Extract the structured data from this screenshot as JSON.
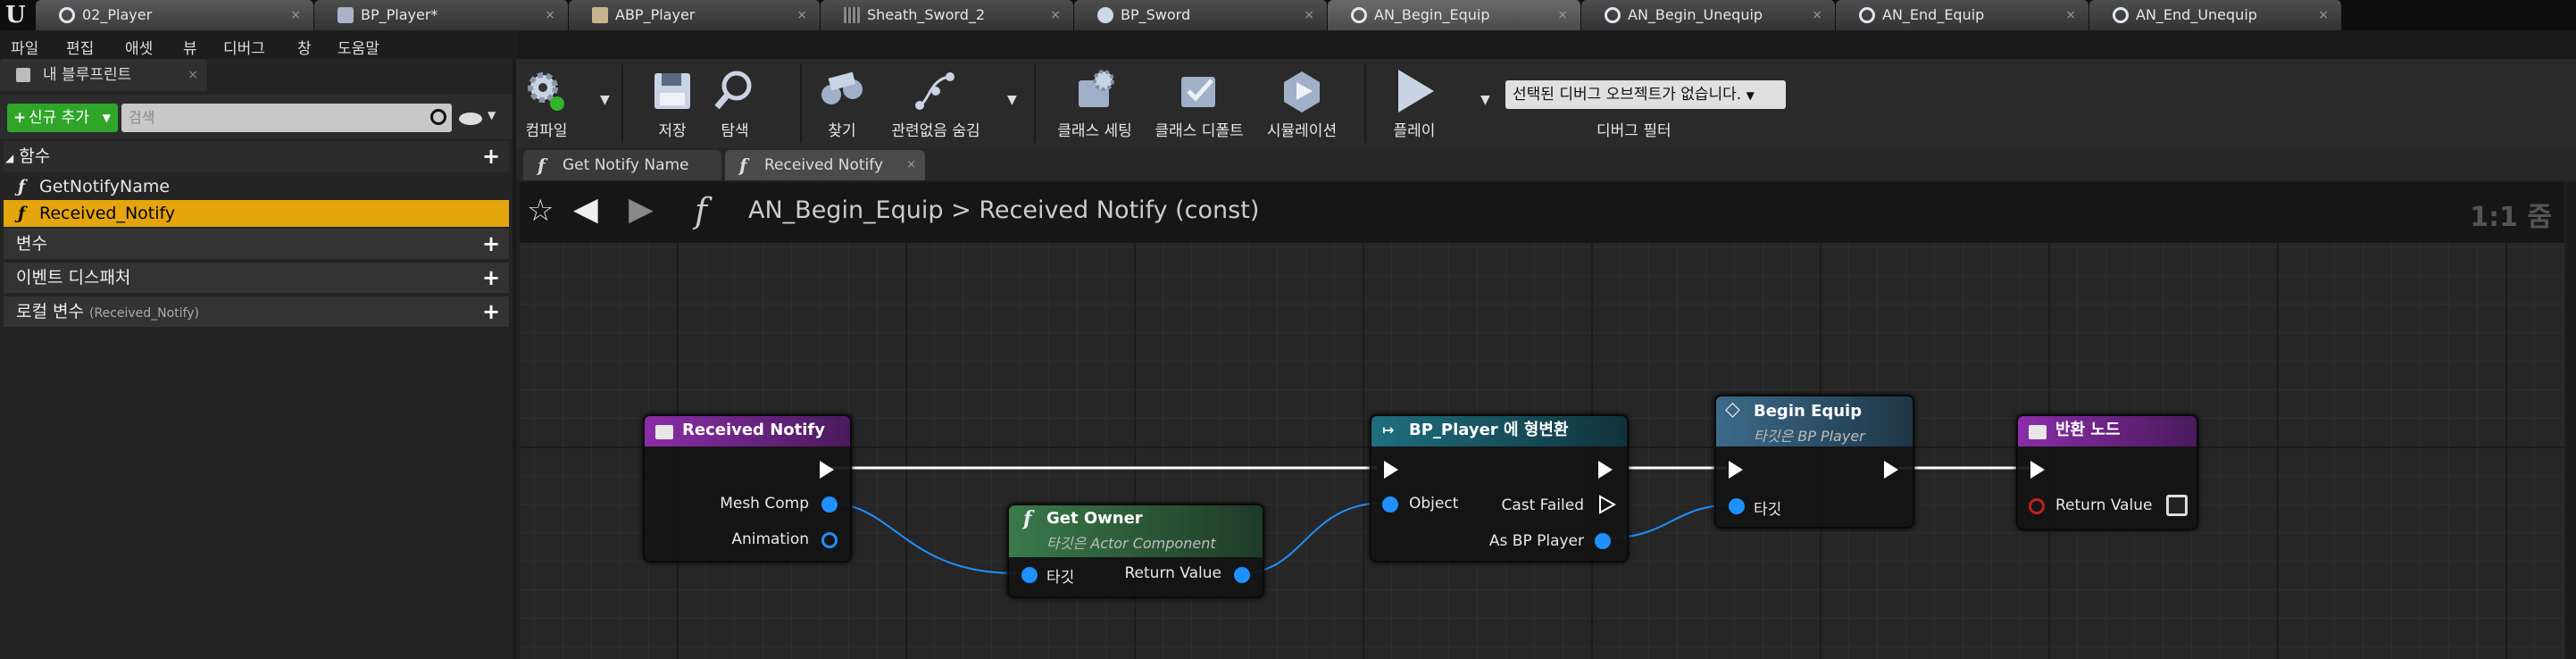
{
  "tabs": [
    "02_Player",
    "BP_Player*",
    "ABP_Player",
    "Sheath_Sword_2",
    "BP_Sword",
    "AN_Begin_Equip",
    "AN_Begin_Unequip",
    "AN_End_Equip",
    "AN_End_Unequip"
  ],
  "menu": [
    "파일",
    "편집",
    "애셋",
    "뷰",
    "디버그",
    "창",
    "도움말"
  ],
  "left_panel": {
    "tab_label": "내 블루프린트",
    "add_button": "신규 추가",
    "search_placeholder": "검색",
    "functions_header": "함수",
    "functions": [
      "GetNotifyName",
      "Received_Notify"
    ],
    "variables_header": "변수",
    "dispatchers_header": "이벤트 디스패처",
    "locals_header": "로컬 변수",
    "locals_sub": "(Received_Notify)"
  },
  "toolbar": {
    "buttons": [
      "컴파일",
      "저장",
      "탐색",
      "찾기",
      "관련없음 숨김",
      "클래스 세팅",
      "클래스 디폴트",
      "시뮬레이션",
      "플레이"
    ],
    "debug_select": "선택된 디버그 오브젝트가 없습니다.",
    "debug_filter": "디버그 필터"
  },
  "doc_tabs": [
    "Get Notify Name",
    "Received Notify"
  ],
  "breadcrumb": {
    "path": "AN_Begin_Equip",
    "sep": ">",
    "current": "Received Notify (const)",
    "zoom": "1:1 줌"
  },
  "nodes": {
    "received_notify": {
      "title": "Received Notify",
      "pins": [
        "Mesh Comp",
        "Animation"
      ],
      "color": "#8a2da8"
    },
    "get_owner": {
      "title": "Get Owner",
      "subtitle": "타깃은 Actor Component",
      "in_pin": "타깃",
      "out_pin": "Return Value",
      "color": "#3a7a4a"
    },
    "cast": {
      "title": "BP_Player 에 형변환",
      "in_pin": "Object",
      "cast_failed": "Cast Failed",
      "out_pin": "As BP Player",
      "color": "#1e6f80"
    },
    "begin_equip": {
      "title": "Begin Equip",
      "subtitle": "타깃은 BP Player",
      "in_pin": "타깃",
      "color": "#3c6a8a"
    },
    "return_node": {
      "title": "반환 노드",
      "pin": "Return Value",
      "color": "#8a2da8"
    }
  }
}
